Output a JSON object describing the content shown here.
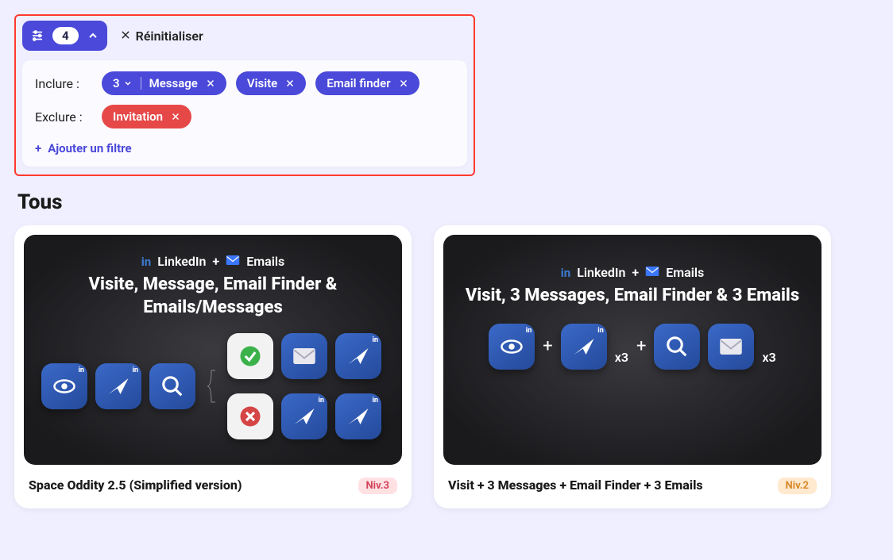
{
  "filters": {
    "count": "4",
    "reset_label": "Réinitialiser",
    "include_label": "Inclure :",
    "exclude_label": "Exclure :",
    "add_filter_label": "Ajouter un filtre",
    "include_chip_dropdown": "3",
    "include_chips": {
      "message": "Message",
      "visite": "Visite",
      "email_finder": "Email finder"
    },
    "exclude_chips": {
      "invitation": "Invitation"
    }
  },
  "section": {
    "title": "Tous"
  },
  "cards": [
    {
      "hero_top_linkedin": "LinkedIn",
      "hero_top_plus": "+",
      "hero_top_emails": "Emails",
      "hero_title": "Visite, Message, Email Finder & Emails/Messages",
      "title": "Space Oddity 2.5 (Simplified version)",
      "level": "Niv.3"
    },
    {
      "hero_top_linkedin": "LinkedIn",
      "hero_top_plus": "+",
      "hero_top_emails": "Emails",
      "hero_title": "Visit, 3 Messages, Email Finder & 3 Emails",
      "mult_x3_a": "x3",
      "mult_x3_b": "x3",
      "title": "Visit + 3 Messages + Email Finder + 3 Emails",
      "level": "Niv.2"
    }
  ]
}
